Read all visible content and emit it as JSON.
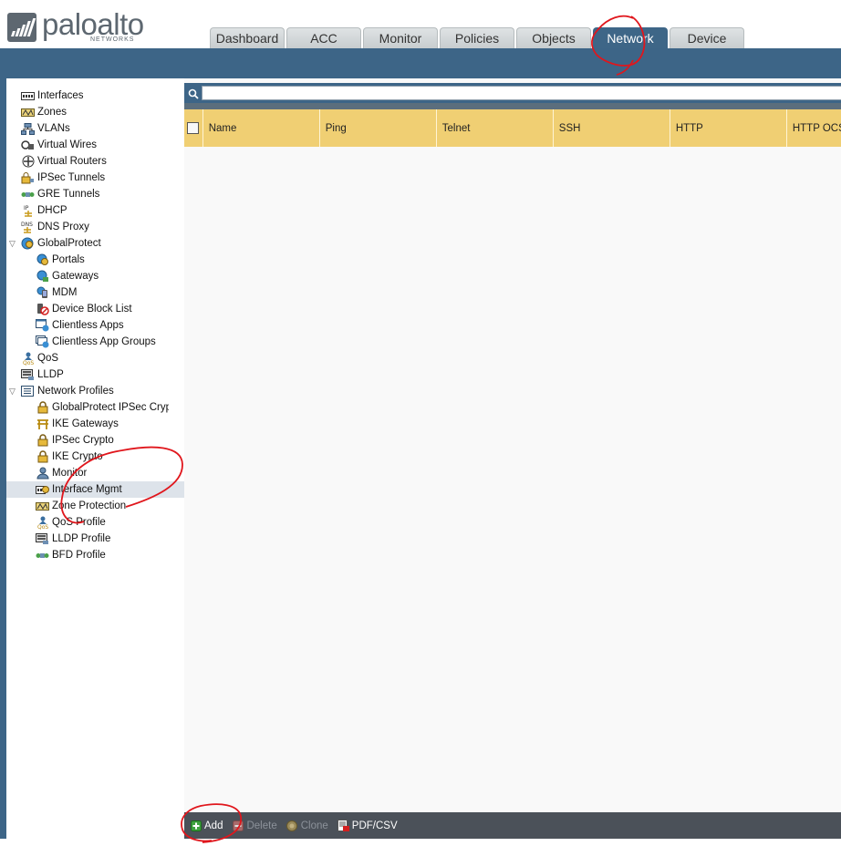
{
  "brand": {
    "name": "paloalto",
    "sub": "NETWORKS"
  },
  "tabs": [
    {
      "label": "Dashboard",
      "active": false
    },
    {
      "label": "ACC",
      "active": false
    },
    {
      "label": "Monitor",
      "active": false
    },
    {
      "label": "Policies",
      "active": false
    },
    {
      "label": "Objects",
      "active": false
    },
    {
      "label": "Network",
      "active": true
    },
    {
      "label": "Device",
      "active": false
    }
  ],
  "sidebar": {
    "items": [
      {
        "label": "Interfaces",
        "icon": "interfaces-icon"
      },
      {
        "label": "Zones",
        "icon": "zones-icon"
      },
      {
        "label": "VLANs",
        "icon": "vlans-icon"
      },
      {
        "label": "Virtual Wires",
        "icon": "virtual-wires-icon"
      },
      {
        "label": "Virtual Routers",
        "icon": "virtual-routers-icon"
      },
      {
        "label": "IPSec Tunnels",
        "icon": "ipsec-tunnels-icon"
      },
      {
        "label": "GRE Tunnels",
        "icon": "gre-tunnels-icon"
      },
      {
        "label": "DHCP",
        "icon": "dhcp-icon"
      },
      {
        "label": "DNS Proxy",
        "icon": "dns-proxy-icon"
      },
      {
        "label": "GlobalProtect",
        "icon": "globalprotect-icon"
      },
      {
        "label": "Portals",
        "icon": "portals-icon"
      },
      {
        "label": "Gateways",
        "icon": "gateways-icon"
      },
      {
        "label": "MDM",
        "icon": "mdm-icon"
      },
      {
        "label": "Device Block List",
        "icon": "device-block-list-icon"
      },
      {
        "label": "Clientless Apps",
        "icon": "clientless-apps-icon"
      },
      {
        "label": "Clientless App Groups",
        "icon": "clientless-app-groups-icon"
      },
      {
        "label": "QoS",
        "icon": "qos-icon"
      },
      {
        "label": "LLDP",
        "icon": "lldp-icon"
      },
      {
        "label": "Network Profiles",
        "icon": "network-profiles-icon"
      },
      {
        "label": "GlobalProtect IPSec Crypto",
        "icon": "lock-icon"
      },
      {
        "label": "IKE Gateways",
        "icon": "ike-gateways-icon"
      },
      {
        "label": "IPSec Crypto",
        "icon": "lock-icon"
      },
      {
        "label": "IKE Crypto",
        "icon": "lock-icon"
      },
      {
        "label": "Monitor",
        "icon": "monitor-profile-icon"
      },
      {
        "label": "Interface Mgmt",
        "icon": "interface-mgmt-icon"
      },
      {
        "label": "Zone Protection",
        "icon": "zone-protection-icon"
      },
      {
        "label": "QoS Profile",
        "icon": "qos-profile-icon"
      },
      {
        "label": "LLDP Profile",
        "icon": "lldp-profile-icon"
      },
      {
        "label": "BFD Profile",
        "icon": "bfd-profile-icon"
      }
    ]
  },
  "search": {
    "placeholder": "",
    "value": ""
  },
  "table": {
    "columns": [
      "Name",
      "Ping",
      "Telnet",
      "SSH",
      "HTTP",
      "HTTP OCSP"
    ],
    "rows": []
  },
  "toolbar": {
    "add": "Add",
    "delete": "Delete",
    "clone": "Clone",
    "pdf_csv": "PDF/CSV"
  },
  "colors": {
    "header_blue": "#3d6587",
    "table_header": "#f0cf73",
    "toolbar_bg": "#4b5159",
    "annotation_red": "#e0161c"
  }
}
